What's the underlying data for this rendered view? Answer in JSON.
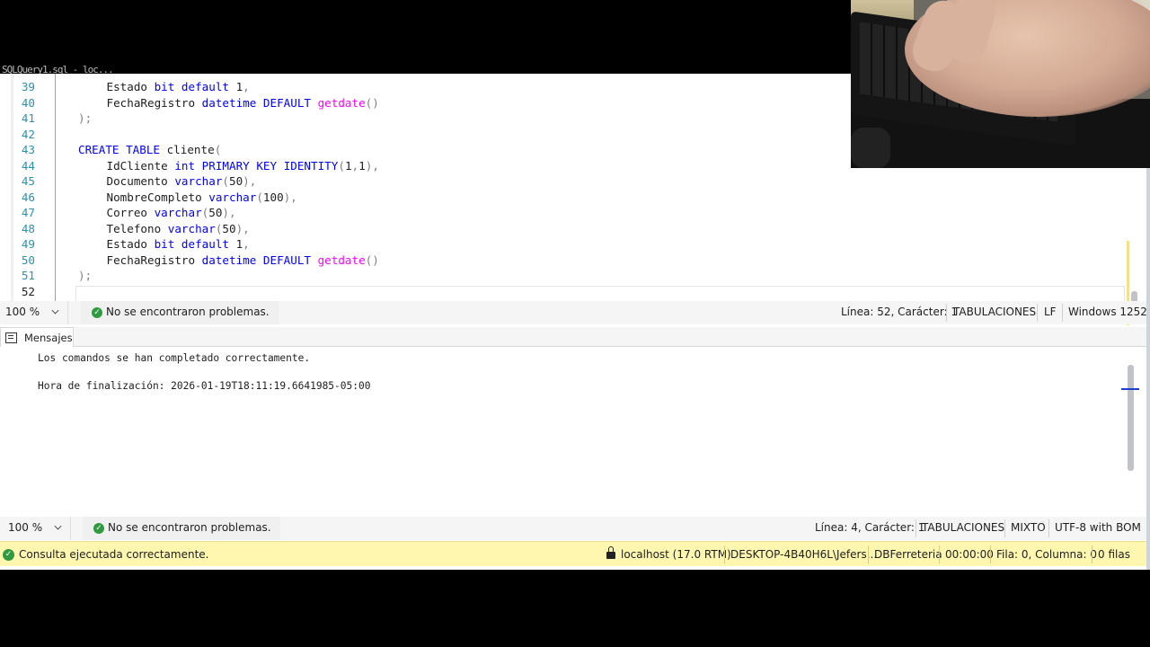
{
  "query_tab": {
    "title": "SQLQuery1.sql - loc..."
  },
  "editor": {
    "lines": [
      {
        "n": "39",
        "indent": 1,
        "parts": [
          [
            "t",
            "Estado "
          ],
          [
            "k",
            "bit"
          ],
          [
            "t",
            " "
          ],
          [
            "k",
            "default"
          ],
          [
            "t",
            " 1"
          ],
          [
            "g",
            ","
          ]
        ]
      },
      {
        "n": "40",
        "indent": 1,
        "parts": [
          [
            "t",
            "FechaRegistro "
          ],
          [
            "k",
            "datetime"
          ],
          [
            "t",
            " "
          ],
          [
            "k",
            "DEFAULT"
          ],
          [
            "t",
            " "
          ],
          [
            "f",
            "getdate"
          ],
          [
            "g",
            "()"
          ]
        ]
      },
      {
        "n": "41",
        "indent": 0,
        "parts": [
          [
            "g",
            ");"
          ]
        ]
      },
      {
        "n": "42",
        "indent": 0,
        "parts": []
      },
      {
        "n": "43",
        "indent": 0,
        "parts": [
          [
            "k",
            "CREATE"
          ],
          [
            "t",
            " "
          ],
          [
            "k",
            "TABLE"
          ],
          [
            "t",
            " cliente"
          ],
          [
            "g",
            "("
          ]
        ]
      },
      {
        "n": "44",
        "indent": 1,
        "parts": [
          [
            "t",
            "IdCliente "
          ],
          [
            "k",
            "int"
          ],
          [
            "t",
            " "
          ],
          [
            "k",
            "PRIMARY"
          ],
          [
            "t",
            " "
          ],
          [
            "k",
            "KEY"
          ],
          [
            "t",
            " "
          ],
          [
            "k",
            "IDENTITY"
          ],
          [
            "g",
            "("
          ],
          [
            "t",
            "1"
          ],
          [
            "g",
            ","
          ],
          [
            "t",
            "1"
          ],
          [
            "g",
            "),"
          ]
        ]
      },
      {
        "n": "45",
        "indent": 1,
        "parts": [
          [
            "t",
            "Documento "
          ],
          [
            "k",
            "varchar"
          ],
          [
            "g",
            "("
          ],
          [
            "t",
            "50"
          ],
          [
            "g",
            "),"
          ]
        ]
      },
      {
        "n": "46",
        "indent": 1,
        "parts": [
          [
            "t",
            "NombreCompleto "
          ],
          [
            "k",
            "varchar"
          ],
          [
            "g",
            "("
          ],
          [
            "t",
            "100"
          ],
          [
            "g",
            "),"
          ]
        ]
      },
      {
        "n": "47",
        "indent": 1,
        "parts": [
          [
            "t",
            "Correo "
          ],
          [
            "k",
            "varchar"
          ],
          [
            "g",
            "("
          ],
          [
            "t",
            "50"
          ],
          [
            "g",
            "),"
          ]
        ]
      },
      {
        "n": "48",
        "indent": 1,
        "parts": [
          [
            "t",
            "Telefono "
          ],
          [
            "k",
            "varchar"
          ],
          [
            "g",
            "("
          ],
          [
            "t",
            "50"
          ],
          [
            "g",
            "),"
          ]
        ]
      },
      {
        "n": "49",
        "indent": 1,
        "parts": [
          [
            "t",
            "Estado "
          ],
          [
            "k",
            "bit"
          ],
          [
            "t",
            " "
          ],
          [
            "k",
            "default"
          ],
          [
            "t",
            " 1"
          ],
          [
            "g",
            ","
          ]
        ]
      },
      {
        "n": "50",
        "indent": 1,
        "parts": [
          [
            "t",
            "FechaRegistro "
          ],
          [
            "k",
            "datetime"
          ],
          [
            "t",
            " "
          ],
          [
            "k",
            "DEFAULT"
          ],
          [
            "t",
            " "
          ],
          [
            "f",
            "getdate"
          ],
          [
            "g",
            "()"
          ]
        ]
      },
      {
        "n": "51",
        "indent": 0,
        "parts": [
          [
            "g",
            ");"
          ]
        ]
      },
      {
        "n": "52",
        "indent": 0,
        "parts": []
      }
    ]
  },
  "editor_status": {
    "zoom": "100 %",
    "problems": "No se encontraron problemas.",
    "position": "Línea: 52, Carácter: 1",
    "indent": "TABULACIONES",
    "line_ending": "LF",
    "encoding": "Windows 1252"
  },
  "messages": {
    "tab_label": "Mensajes",
    "lines": [
      "Los comandos se han completado correctamente.",
      "Hora de finalización: 2026-01-19T18:11:19.6641985-05:00"
    ]
  },
  "results_status": {
    "zoom": "100 %",
    "problems": "No se encontraron problemas.",
    "position": "Línea: 4, Carácter: 1",
    "indent": "TABULACIONES",
    "line_ending": "MIXTO",
    "encoding": "UTF-8 with BOM"
  },
  "query_status": {
    "message": "Consulta ejecutada correctamente.",
    "server": "localhost (17.0 RTM)",
    "user": "DESKTOP-4B40H6L\\Jefers...",
    "database": "DBFerreteria",
    "elapsed": "00:00:00",
    "cursor": "Fila: 0, Columna: 0",
    "rows": "0 filas"
  },
  "colors": {
    "keyword": "#0000ff",
    "function": "#ff00ff",
    "operator": "#808080",
    "line_number": "#2b91af",
    "status_yellow": "#fff7b0",
    "ok_green": "#2f9a3f"
  },
  "icons": [
    "check-circle-icon",
    "chevron-down-icon",
    "messages-icon",
    "lock-icon"
  ]
}
